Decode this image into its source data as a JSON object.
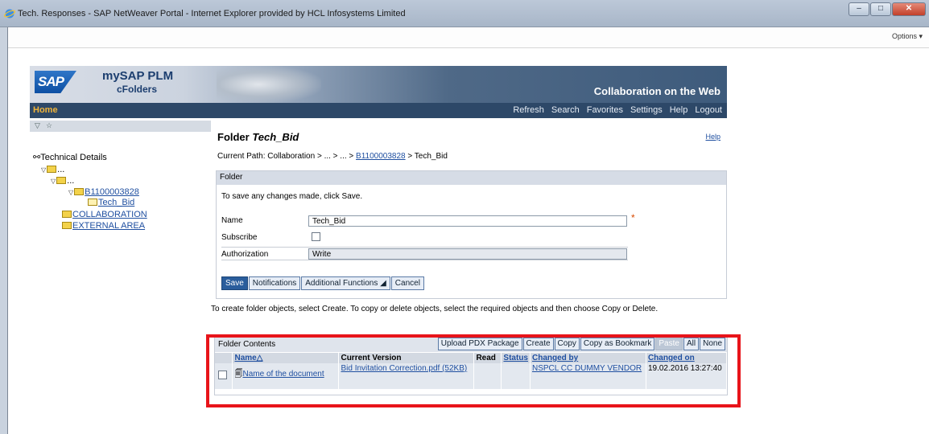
{
  "window": {
    "title": "Tech. Responses - SAP NetWeaver Portal - Internet Explorer provided by HCL Infosystems Limited",
    "options_label": "Options ▾",
    "controls": {
      "minimize": "–",
      "maximize": "□",
      "close": "✕"
    }
  },
  "header": {
    "logo": "SAP",
    "product": "mySAP PLM",
    "subproduct": "cFolders",
    "banner_title": "Collaboration on the Web"
  },
  "nav": {
    "home": "Home",
    "links": [
      "Refresh",
      "Search",
      "Favorites",
      "Settings",
      "Help",
      "Logout"
    ]
  },
  "tree": {
    "toolbar_icons": [
      "▽",
      "☆"
    ],
    "root": "Technical Details",
    "level1": "...",
    "level2": "...",
    "level3": "B1100003828",
    "level4": "Tech_Bid",
    "collab": "COLLABORATION",
    "external": "EXTERNAL AREA"
  },
  "main": {
    "title_prefix": "Folder ",
    "title_name": "Tech_Bid",
    "help": "Help",
    "path_label": "Current Path:  Collaboration > ... > ... > ",
    "path_link": "B1100003828",
    "path_current": " > Tech_Bid",
    "panel_title": "Folder",
    "hint": "To save any changes made, click Save.",
    "name_label": "Name",
    "name_value": "Tech_Bid",
    "required_mark": "*",
    "subscribe_label": "Subscribe",
    "auth_label": "Authorization",
    "auth_value": "Write",
    "buttons": {
      "save": "Save",
      "notifications": "Notifications",
      "additional": "Additional Functions ◢",
      "cancel": "Cancel"
    },
    "info": "To create folder objects, select Create. To copy or delete objects, select the required objects and then choose Copy or Delete."
  },
  "contents": {
    "label": "Folder Contents",
    "toolbar": [
      "Upload PDX Package",
      "Create",
      "Copy",
      "Copy as Bookmark",
      "Paste",
      "All",
      "None"
    ],
    "columns": [
      "Name△",
      "Current Version",
      "Read",
      "Status",
      "Changed by",
      "Changed on"
    ],
    "rows": [
      {
        "name": "Name of the document",
        "version": "Bid Invitation Correction.pdf (52KB)",
        "read": "",
        "status": "",
        "changed_by": "NSPCL CC DUMMY VENDOR",
        "changed_on": "19.02.2016 13:27:40"
      }
    ]
  },
  "colors": {
    "nav_bg": "#2d4868",
    "home": "#f0b43a",
    "highlight": "#e8141a",
    "link": "#1f4fa0"
  }
}
